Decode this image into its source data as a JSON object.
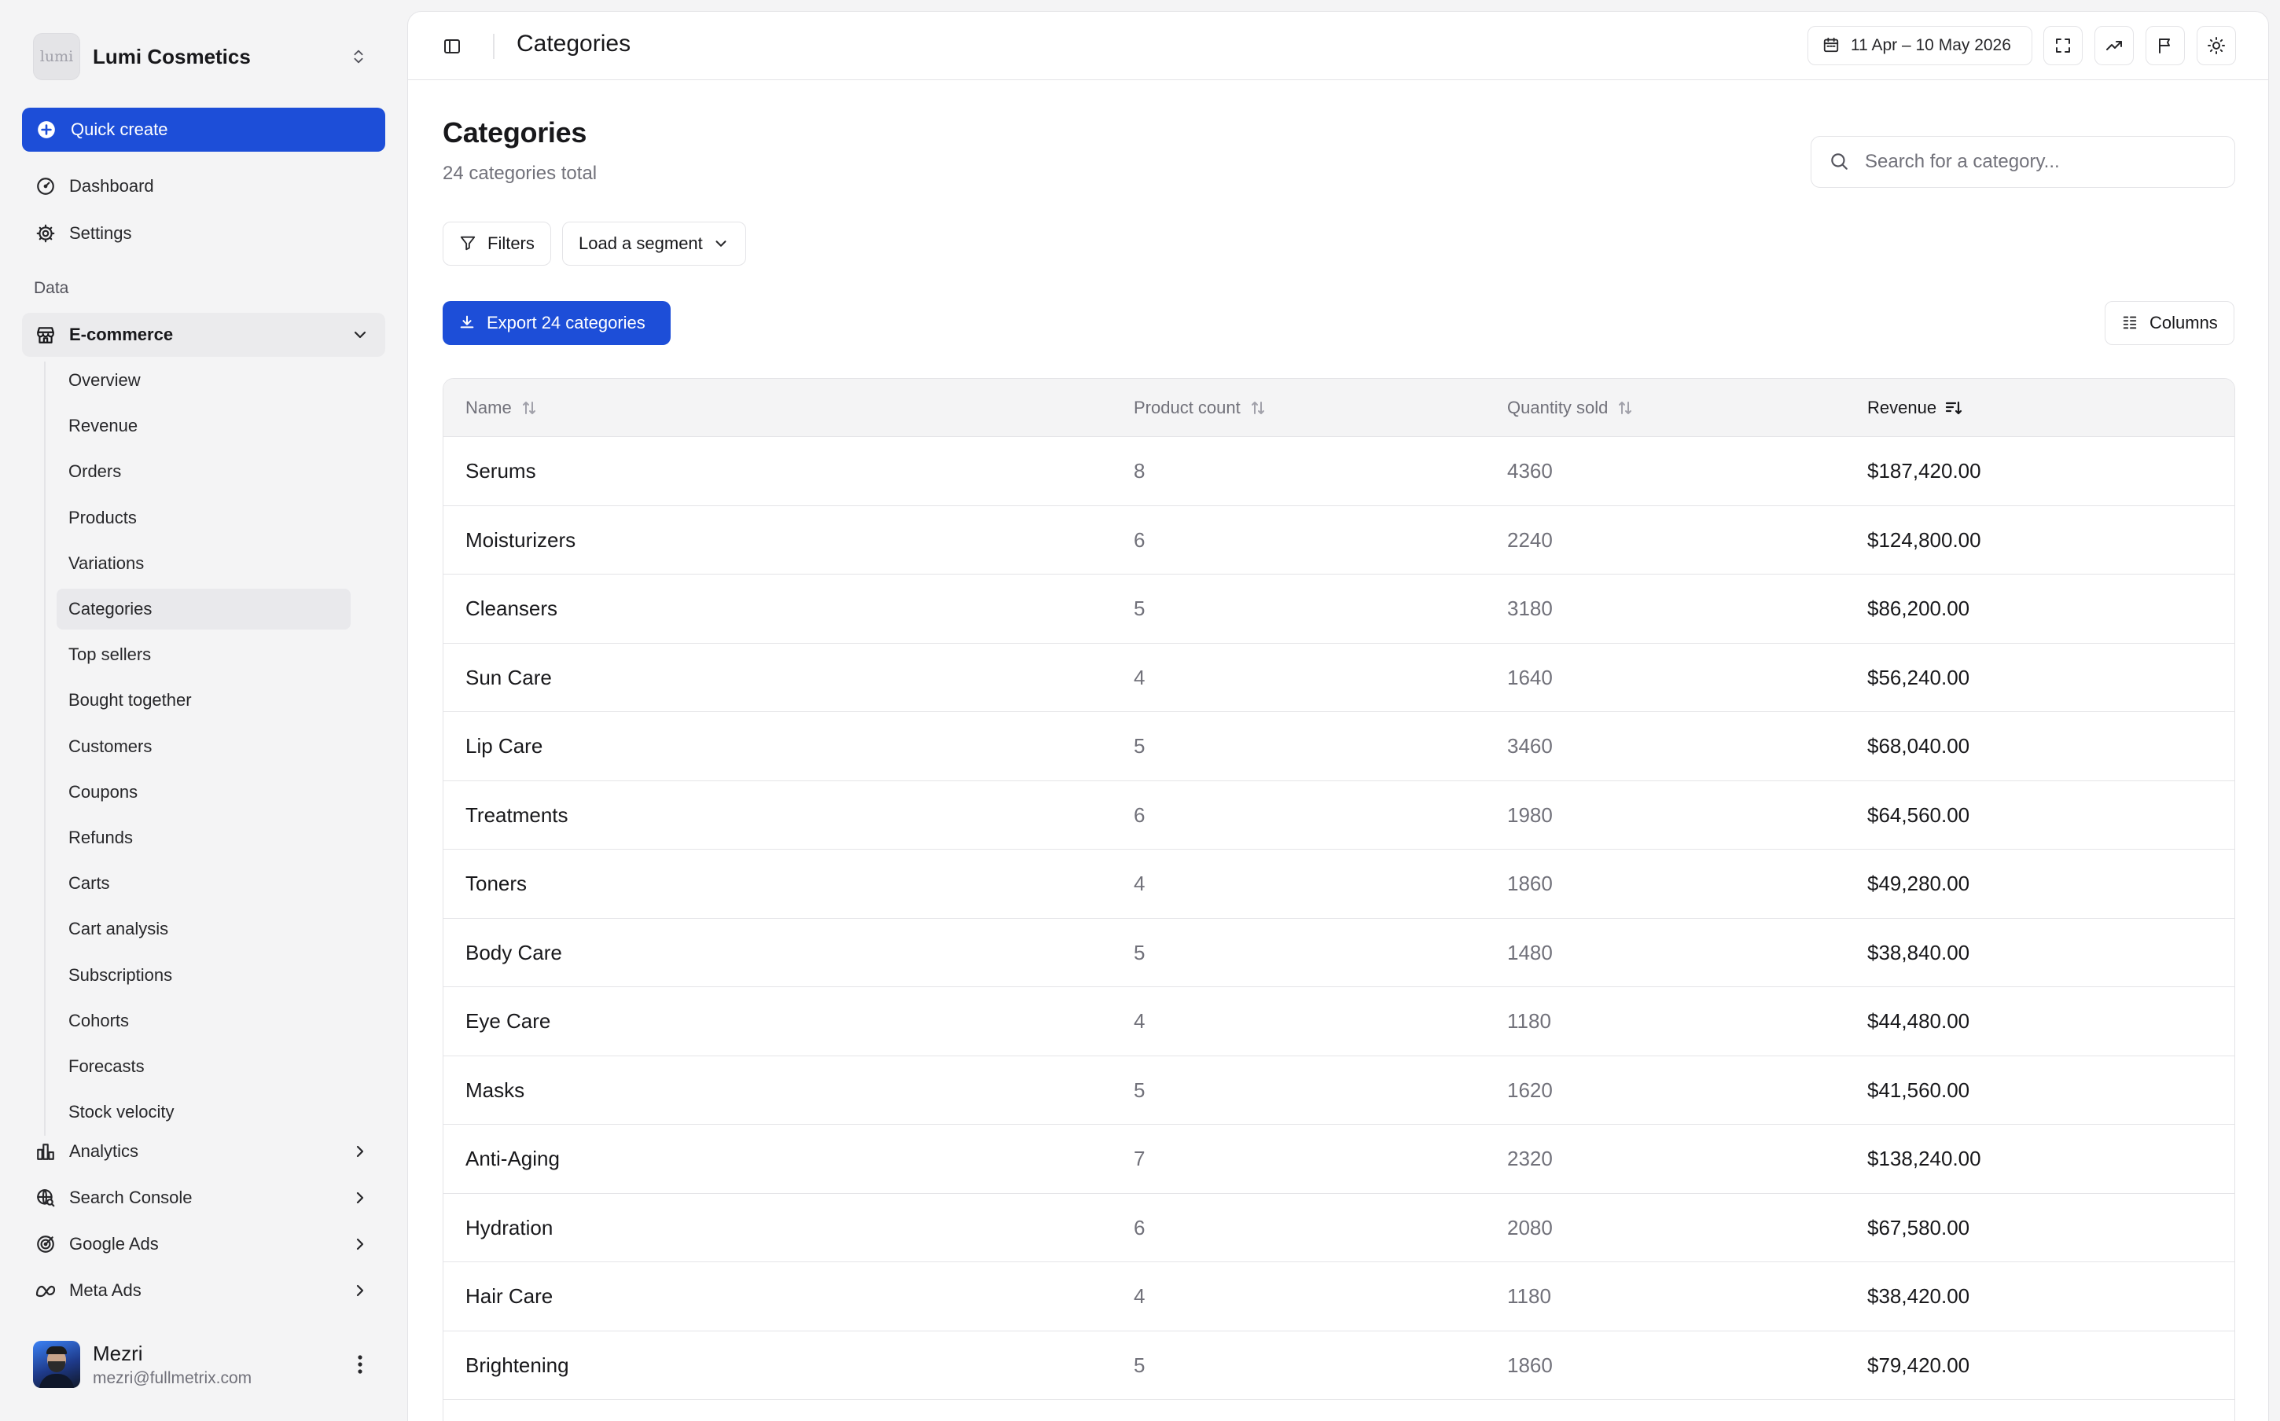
{
  "sidebar": {
    "org": {
      "logo_text": "lumi",
      "name": "Lumi Cosmetics"
    },
    "quick_create": "Quick create",
    "top_items": [
      {
        "label": "Dashboard",
        "icon": "dashboard-icon"
      },
      {
        "label": "Settings",
        "icon": "gear-icon"
      }
    ],
    "section_label": "Data",
    "ecommerce": {
      "label": "E-commerce",
      "icon": "store-icon"
    },
    "sub_items": [
      "Overview",
      "Revenue",
      "Orders",
      "Products",
      "Variations",
      "Categories",
      "Top sellers",
      "Bought together",
      "Customers",
      "Coupons",
      "Refunds",
      "Carts",
      "Cart analysis",
      "Subscriptions",
      "Cohorts",
      "Forecasts",
      "Stock velocity"
    ],
    "active_sub_item": "Categories",
    "bottom_items": [
      {
        "label": "Analytics",
        "icon": "bar-chart-icon"
      },
      {
        "label": "Search Console",
        "icon": "globe-search-icon"
      },
      {
        "label": "Google Ads",
        "icon": "target-icon"
      },
      {
        "label": "Meta Ads",
        "icon": "meta-icon"
      }
    ],
    "user": {
      "name": "Mezri",
      "email": "mezri@fullmetrix.com"
    }
  },
  "topbar": {
    "title": "Categories",
    "date_range": "11 Apr – 10 May 2026"
  },
  "page": {
    "title": "Categories",
    "subtitle": "24 categories total",
    "search_placeholder": "Search for a category...",
    "filters_label": "Filters",
    "segment_label": "Load a segment",
    "export_label": "Export 24 categories",
    "columns_label": "Columns"
  },
  "table": {
    "headers": {
      "name": "Name",
      "count": "Product count",
      "qty": "Quantity sold",
      "revenue": "Revenue"
    },
    "sorted_column": "revenue",
    "rows": [
      {
        "name": "Serums",
        "count": "8",
        "qty": "4360",
        "revenue": "$187,420.00"
      },
      {
        "name": "Moisturizers",
        "count": "6",
        "qty": "2240",
        "revenue": "$124,800.00"
      },
      {
        "name": "Cleansers",
        "count": "5",
        "qty": "3180",
        "revenue": "$86,200.00"
      },
      {
        "name": "Sun Care",
        "count": "4",
        "qty": "1640",
        "revenue": "$56,240.00"
      },
      {
        "name": "Lip Care",
        "count": "5",
        "qty": "3460",
        "revenue": "$68,040.00"
      },
      {
        "name": "Treatments",
        "count": "6",
        "qty": "1980",
        "revenue": "$64,560.00"
      },
      {
        "name": "Toners",
        "count": "4",
        "qty": "1860",
        "revenue": "$49,280.00"
      },
      {
        "name": "Body Care",
        "count": "5",
        "qty": "1480",
        "revenue": "$38,840.00"
      },
      {
        "name": "Eye Care",
        "count": "4",
        "qty": "1180",
        "revenue": "$44,480.00"
      },
      {
        "name": "Masks",
        "count": "5",
        "qty": "1620",
        "revenue": "$41,560.00"
      },
      {
        "name": "Anti-Aging",
        "count": "7",
        "qty": "2320",
        "revenue": "$138,240.00"
      },
      {
        "name": "Hydration",
        "count": "6",
        "qty": "2080",
        "revenue": "$67,580.00"
      },
      {
        "name": "Hair Care",
        "count": "4",
        "qty": "1180",
        "revenue": "$38,420.00"
      },
      {
        "name": "Brightening",
        "count": "5",
        "qty": "1860",
        "revenue": "$79,420.00"
      }
    ]
  },
  "colors": {
    "accent": "#1d4ed8",
    "sidebar_bg": "#f4f4f5",
    "border": "#e4e4e7",
    "muted_text": "#71717a"
  }
}
